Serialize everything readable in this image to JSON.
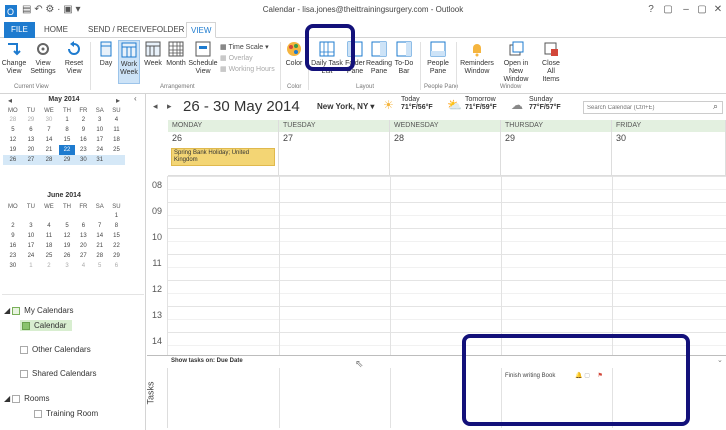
{
  "window": {
    "title": "Calendar - lisa.jones@theittrainingsurgery.com - Outlook",
    "help": "?",
    "restore": "▢",
    "minimize": "–",
    "close": "✕"
  },
  "tabs": [
    "FILE",
    "HOME",
    "SEND / RECEIVE",
    "FOLDER",
    "VIEW"
  ],
  "ribbon": {
    "current_view": {
      "label": "Current View",
      "buttons": [
        "Change View",
        "View Settings",
        "Reset View"
      ]
    },
    "arrangement": {
      "label": "Arrangement",
      "buttons": [
        "Day",
        "Work Week",
        "Week",
        "Month",
        "Schedule View"
      ],
      "small": [
        "Time Scale",
        "Overlay",
        "Working Hours"
      ]
    },
    "color": {
      "label": "Color",
      "button": "Color"
    },
    "layout": {
      "label": "Layout",
      "buttons": [
        "Daily Task List",
        "Folder Pane",
        "Reading Pane",
        "To-Do Bar"
      ]
    },
    "people_pane": {
      "label": "People Pane",
      "button": "People Pane"
    },
    "window": {
      "label": "Window",
      "buttons": [
        "Reminders Window",
        "Open in New Window",
        "Close All Items"
      ]
    }
  },
  "minical": {
    "may": {
      "title": "May 2014",
      "days": [
        "MO",
        "TU",
        "WE",
        "TH",
        "FR",
        "SA",
        "SU"
      ],
      "weeks": [
        [
          "28",
          "29",
          "30",
          "1",
          "2",
          "3",
          "4"
        ],
        [
          "5",
          "6",
          "7",
          "8",
          "9",
          "10",
          "11"
        ],
        [
          "12",
          "13",
          "14",
          "15",
          "16",
          "17",
          "18"
        ],
        [
          "19",
          "20",
          "21",
          "22",
          "23",
          "24",
          "25"
        ],
        [
          "26",
          "27",
          "28",
          "29",
          "30",
          "31",
          ""
        ]
      ]
    },
    "june": {
      "title": "June 2014",
      "days": [
        "MO",
        "TU",
        "WE",
        "TH",
        "FR",
        "SA",
        "SU"
      ],
      "weeks": [
        [
          "",
          "",
          "",
          "",
          "",
          "",
          "1"
        ],
        [
          "2",
          "3",
          "4",
          "5",
          "6",
          "7",
          "8"
        ],
        [
          "9",
          "10",
          "11",
          "12",
          "13",
          "14",
          "15"
        ],
        [
          "16",
          "17",
          "18",
          "19",
          "20",
          "21",
          "22"
        ],
        [
          "23",
          "24",
          "25",
          "26",
          "27",
          "28",
          "29"
        ],
        [
          "30",
          "1",
          "2",
          "3",
          "4",
          "5",
          "6"
        ]
      ]
    }
  },
  "calendars": {
    "my_calendars": "My Calendars",
    "calendar": "Calendar",
    "other": "Other Calendars",
    "shared": "Shared Calendars",
    "rooms": "Rooms",
    "training_room": "Training Room"
  },
  "main": {
    "date_range": "26 - 30 May 2014",
    "location": "New York, NY",
    "weather": [
      {
        "label": "Today",
        "temp": "71°F/56°F"
      },
      {
        "label": "Tomorrow",
        "temp": "71°F/59°F"
      },
      {
        "label": "Sunday",
        "temp": "77°F/57°F"
      }
    ],
    "search_placeholder": "Search Calendar (Ctrl+E)",
    "day_headers": [
      "MONDAY",
      "TUESDAY",
      "WEDNESDAY",
      "THURSDAY",
      "FRIDAY"
    ],
    "day_numbers": [
      "26",
      "27",
      "28",
      "29",
      "30"
    ],
    "event": "Spring Bank Holiday; United Kingdom",
    "hours": [
      "08",
      "09",
      "10",
      "11",
      "12",
      "13",
      "14"
    ],
    "tasks_header": "Show tasks on: Due Date",
    "tasks_label": "Tasks",
    "task_item": "Finish writing Book"
  }
}
